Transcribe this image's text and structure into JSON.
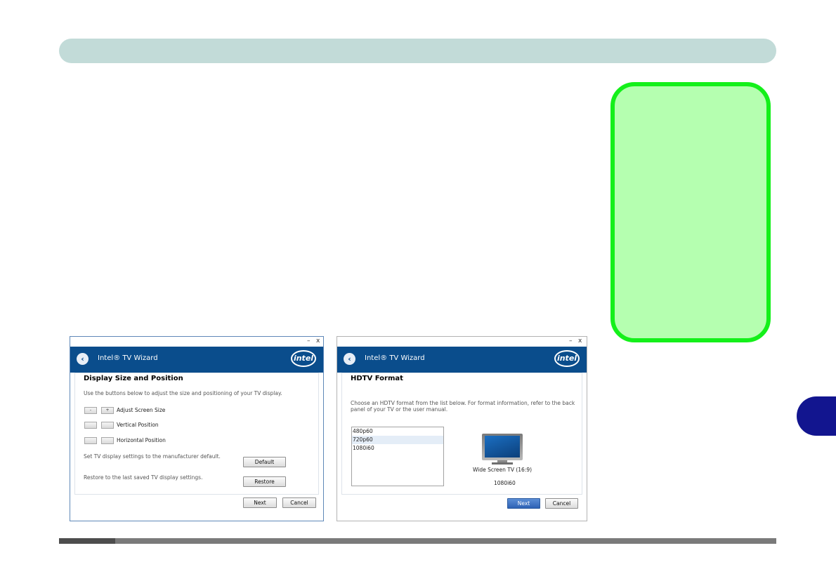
{
  "page": {
    "colors": {
      "header_bar": "#c2dbd8",
      "note_box_fill": "#b5ffb0",
      "note_box_border": "#14f01a",
      "chapter_tab": "#12158f",
      "footer": "#7a7a7a",
      "banner": "#0a4d8c"
    }
  },
  "window_controls": {
    "minimize": "–",
    "close": "x"
  },
  "dialog1": {
    "back_icon": "‹",
    "title": "Intel® TV Wizard",
    "logo": "intel",
    "section_title": "Display Size and Position",
    "description": "Use the buttons below to adjust the size and positioning of your TV display.",
    "rows": [
      {
        "minus": "-",
        "plus": "+",
        "label": "Adjust Screen Size"
      },
      {
        "minus": "",
        "plus": "",
        "label": "Vertical Position"
      },
      {
        "minus": "",
        "plus": "",
        "label": "Horizontal Position"
      }
    ],
    "default_text": "Set TV display settings to the manufacturer default.",
    "default_button": "Default",
    "restore_text": "Restore to the last saved TV display settings.",
    "restore_button": "Restore",
    "next_button": "Next",
    "cancel_button": "Cancel"
  },
  "dialog2": {
    "back_icon": "‹",
    "title": "Intel® TV Wizard",
    "logo": "intel",
    "section_title": "HDTV Format",
    "description_line1": "Choose an HDTV format from the list below. For format information, refer to the back",
    "description_line2": "panel of your TV or the user manual.",
    "formats": [
      "480p60",
      "720p60",
      "1080i60"
    ],
    "selected_format": "720p60",
    "tv_type": "Wide Screen TV (16:9)",
    "tv_format": "1080i60",
    "next_button": "Next",
    "cancel_button": "Cancel"
  }
}
